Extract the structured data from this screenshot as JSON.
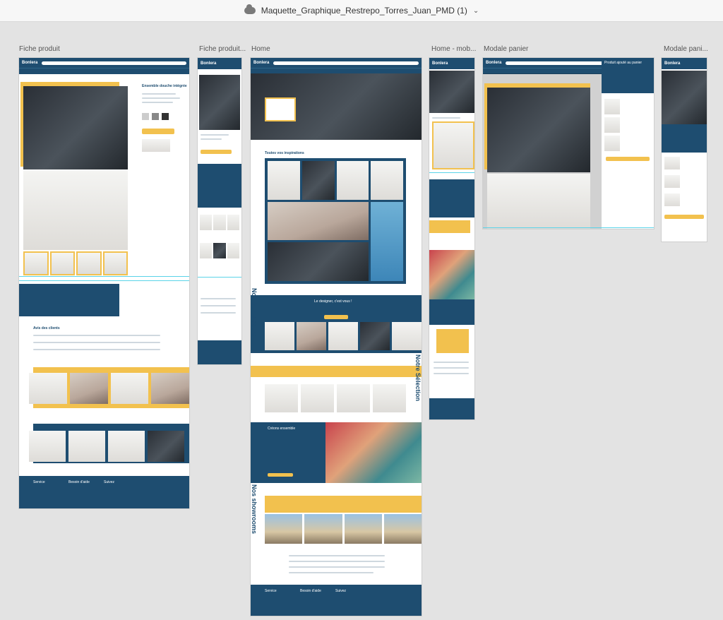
{
  "window": {
    "file_title": "Maquette_Graphique_Restrepo_Torres_Juan_PMD (1)",
    "icons": {
      "cloud": "cloud-icon",
      "dropdown": "chevron-down-icon"
    }
  },
  "artboards": [
    {
      "label": "Fiche produit"
    },
    {
      "label": "Fiche produit..."
    },
    {
      "label": "Home"
    },
    {
      "label": "Home - mob..."
    },
    {
      "label": "Modale panier"
    },
    {
      "label": "Modale pani..."
    }
  ],
  "snippets": {
    "brand": "Bonlera",
    "home_inspiration": "Toutes vos inspirations",
    "home_designer": "Le designer, c'est vous !",
    "notre_selection": "Notre Sélection",
    "nos_sur_mesure": "Nos Sur mesure",
    "nos_showrooms": "Nos showrooms",
    "creons_ensemble": "Créons ensemble",
    "product_title": "Ensemble douche intégrée",
    "cart_title": "Produit ajouté au panier",
    "reviews": "Avis des clients",
    "footer_service": "Service",
    "footer_besoin": "Besoin d'aide",
    "footer_suivez": "Suivez"
  },
  "colors": {
    "brand_dark": "#1e4d70",
    "brand_yellow": "#f2c14e",
    "canvas": "#e3e3e3",
    "guide": "#5ad3e8"
  }
}
